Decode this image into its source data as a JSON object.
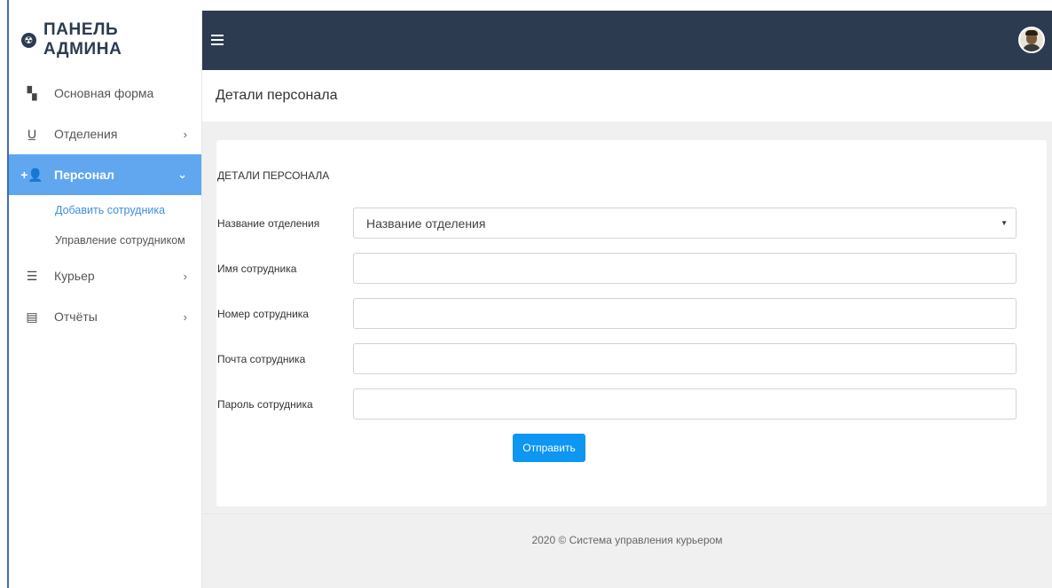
{
  "brand": {
    "logo_glyph": "☢",
    "title": "ПАНЕЛЬ АДМИНА"
  },
  "sidebar": {
    "items": [
      {
        "label": "Основная форма",
        "icon": "dashboard-icon",
        "glyph": "▚"
      },
      {
        "label": "Отделения",
        "icon": "u-underline-icon",
        "glyph": "U̲",
        "chevron": "›"
      },
      {
        "label": "Персонал",
        "icon": "add-user-icon",
        "glyph": "+👤",
        "chevron": "⌄"
      },
      {
        "label": "Курьер",
        "icon": "list-icon",
        "glyph": "☰",
        "chevron": "›"
      },
      {
        "label": "Отчёты",
        "icon": "reports-icon",
        "glyph": "▤",
        "chevron": "›"
      }
    ],
    "subitems": [
      {
        "label": "Добавить сотрудника"
      },
      {
        "label": "Управление сотрудником"
      }
    ]
  },
  "header": {
    "title": "Детали персонала"
  },
  "form": {
    "title": "ДЕТАЛИ ПЕРСОНАЛА",
    "department_label": "Название отделения",
    "department_value": "Название отделения",
    "name_label": "Имя сотрудника",
    "number_label": "Номер сотрудника",
    "email_label": "Почта сотрудника",
    "password_label": "Пароль сотрудника",
    "submit_label": "Отправить"
  },
  "footer": {
    "text": "2020 © Система управления курьером"
  },
  "colors": {
    "topbar": "#2c3b50",
    "active_nav": "#60a7f0",
    "primary_button": "#0d96f2",
    "link_active": "#3d8fe0"
  }
}
